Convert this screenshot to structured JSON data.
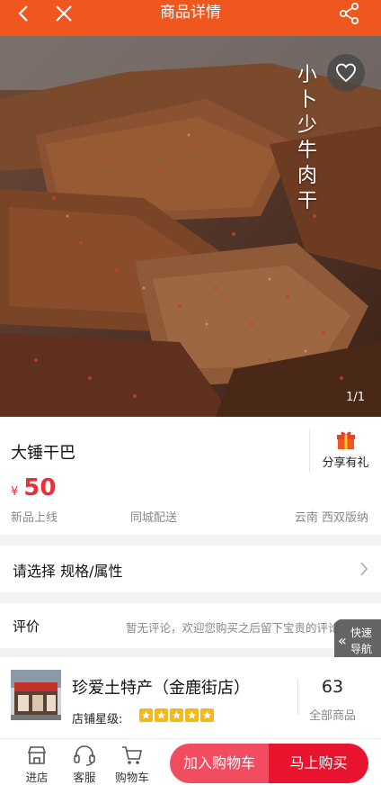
{
  "header": {
    "title": "商品详情"
  },
  "hero": {
    "overlay_text": "小卜少牛肉干",
    "pager": "1/1"
  },
  "product": {
    "name": "大锤干巴",
    "share_label": "分享有礼",
    "currency": "¥",
    "price": "50",
    "tag_new": "新品上线",
    "tag_delivery": "同城配送",
    "origin": "云南 西双版纳"
  },
  "spec": {
    "label": "请选择 规格/属性"
  },
  "review": {
    "label": "评价",
    "empty_text": "暂无评论，欢迎您购买之后留下宝贵的评论"
  },
  "quick_nav": {
    "line1": "快速",
    "line2": "导航"
  },
  "store": {
    "name": "珍爱土特产（金鹿街店）",
    "rating_label": "店铺星级:",
    "rating": 5,
    "product_count": "63",
    "product_count_label": "全部商品"
  },
  "bottom": {
    "tab_store": "进店",
    "tab_service": "客服",
    "tab_cart": "购物车",
    "add_cart": "加入购物车",
    "buy_now": "马上购买"
  },
  "colors": {
    "header": "#f0571e",
    "price": "#e8303a",
    "add_cart": "#f24c61",
    "buy_now": "#e8132c",
    "star": "#f5b819"
  }
}
